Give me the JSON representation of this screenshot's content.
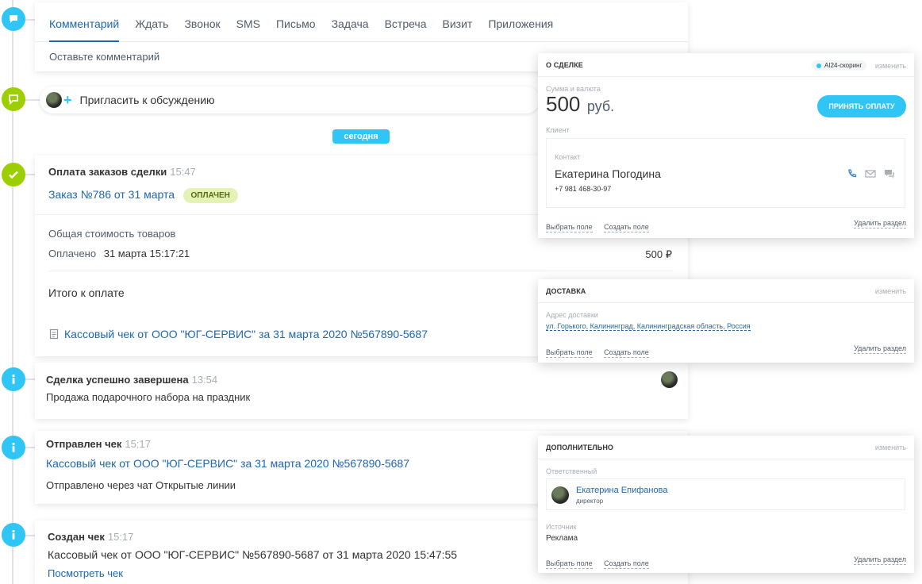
{
  "composer": {
    "tabs": [
      "Комментарий",
      "Ждать",
      "Звонок",
      "SMS",
      "Письмо",
      "Задача",
      "Встреча",
      "Визит",
      "Приложения"
    ],
    "placeholder": "Оставьте комментарий"
  },
  "invite": {
    "label": "Пригласить к обсуждению",
    "plus": "+"
  },
  "today_label": "сегодня",
  "payment_event": {
    "title": "Оплата заказов сделки",
    "time": "15:47",
    "order_link": "Заказ №786 от 31 марта",
    "badge": "оплачен",
    "total_label": "Общая стоимость товаров",
    "paid_label": "Оплачено",
    "paid_date": "31 марта 15:17:21",
    "paid_amount": "500 ₽",
    "to_pay_label": "Итого к оплате",
    "receipt_link": "Кассовый чек от ООО \"ЮГ-СЕРВИС\" за 31 марта 2020 №567890-5687"
  },
  "deal_done_event": {
    "title": "Сделка успешно завершена",
    "time": "13:54",
    "text": "Продажа подарочного набора на праздник"
  },
  "receipt_sent_event": {
    "title": "Отправлен чек",
    "time": "15:17",
    "link": "Кассовый чек от ООО \"ЮГ-СЕРВИС\" за 31 марта 2020 №567890-5687",
    "text": "Отправлено через чат Открытые линии"
  },
  "receipt_created_event": {
    "title": "Создан чек",
    "time": "15:17",
    "text": "Кассовый чек от ООО \"ЮГ-СЕРВИС\" №567890-5687 от 31 марта 2020 15:47:55",
    "link": "Посмотреть чек"
  },
  "deal_panel": {
    "title": "О СДЕЛКЕ",
    "ai_label": "AI24-скоринг",
    "edit": "изменить",
    "amount_label": "Сумма и валюта",
    "amount": "500",
    "currency": "руб.",
    "pay_button": "ПРИНЯТЬ ОПЛАТУ",
    "client_label": "Клиент",
    "contact_label": "Контакт",
    "contact_name": "Екатерина Погодина",
    "contact_phone": "+7 981 468-30-97",
    "select_field": "Выбрать поле",
    "create_field": "Создать поле",
    "delete_section": "Удалить раздел"
  },
  "delivery_panel": {
    "title": "ДОСТАВКА",
    "edit": "изменить",
    "address_label": "Адрес доставки",
    "address": "ул. Горького, Калининград, Калининградская область, Россия",
    "select_field": "Выбрать поле",
    "create_field": "Создать поле",
    "delete_section": "Удалить раздел"
  },
  "extra_panel": {
    "title": "ДОПОЛНИТЕЛЬНО",
    "edit": "изменить",
    "responsible_label": "Ответственный",
    "responsible_name": "Екатерина Епифанова",
    "responsible_role": "директор",
    "source_label": "Источник",
    "source_value": "Реклама",
    "select_field": "Выбрать поле",
    "create_field": "Создать поле",
    "delete_section": "Удалить раздел"
  },
  "icons": {
    "comment": "chat-bubble-icon",
    "invite": "discussion-icon",
    "payment": "check-icon",
    "info": "info-icon"
  },
  "colors": {
    "accent": "#2fc6f6",
    "link": "#2067b0",
    "success": "#9dcf00",
    "badge_bg": "#e5f2b6"
  }
}
